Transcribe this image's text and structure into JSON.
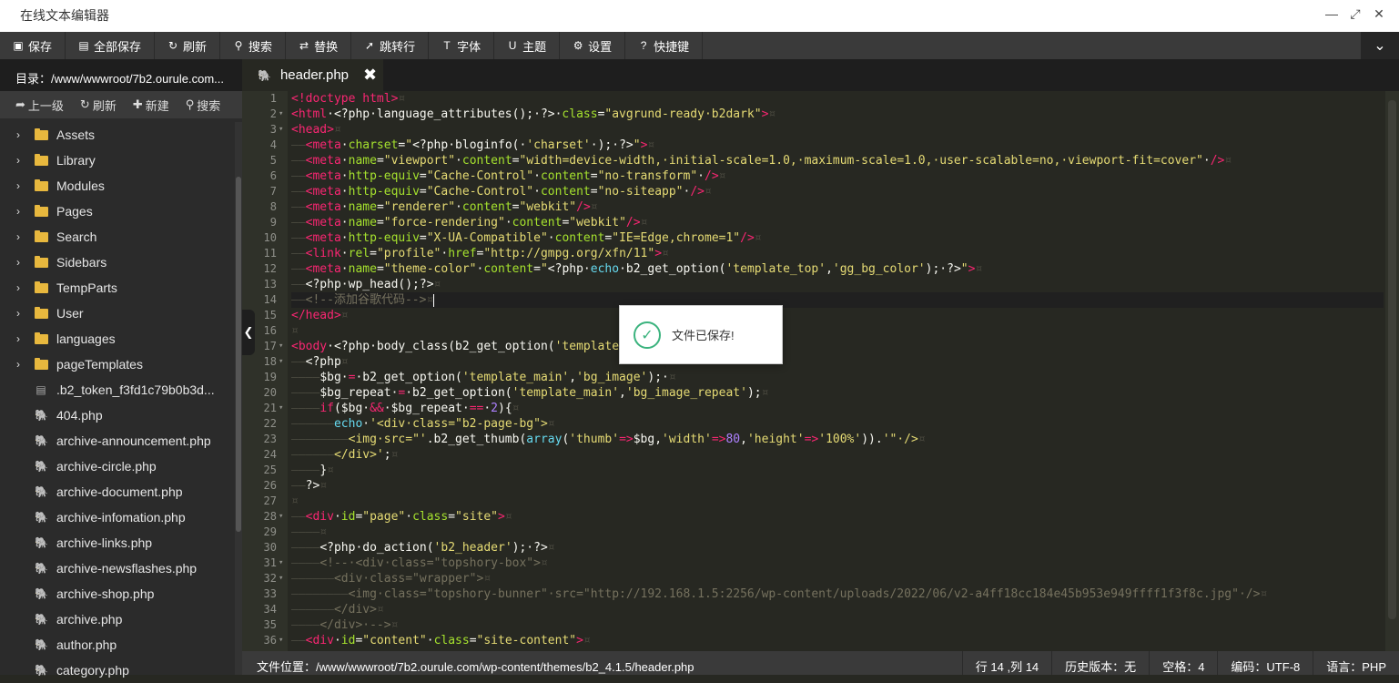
{
  "window": {
    "title": "在线文本编辑器"
  },
  "toolbar": {
    "buttons": [
      {
        "icon": "save-icon",
        "label": "保存"
      },
      {
        "icon": "file-icon",
        "label": "全部保存"
      },
      {
        "icon": "refresh-icon",
        "label": "刷新"
      },
      {
        "icon": "search-icon",
        "label": "搜索"
      },
      {
        "icon": "replace-icon",
        "label": "替换"
      },
      {
        "icon": "goto-line-icon",
        "label": "跳转行"
      },
      {
        "icon": "font-icon",
        "label": "字体"
      },
      {
        "icon": "theme-icon",
        "label": "主题"
      },
      {
        "icon": "gear-icon",
        "label": "设置"
      },
      {
        "icon": "help-icon",
        "label": "快捷键"
      }
    ]
  },
  "sidebar": {
    "dir": "目录：/www/wwwroot/7b2.ourule.com...",
    "tools": [
      {
        "icon": "up-arrow-icon",
        "label": "上一级"
      },
      {
        "icon": "refresh-icon",
        "label": "刷新"
      },
      {
        "icon": "plus-icon",
        "label": "新建"
      },
      {
        "icon": "search-icon",
        "label": "搜索"
      }
    ],
    "items": [
      {
        "type": "folder",
        "label": "Assets"
      },
      {
        "type": "folder",
        "label": "Library"
      },
      {
        "type": "folder",
        "label": "Modules"
      },
      {
        "type": "folder",
        "label": "Pages"
      },
      {
        "type": "folder",
        "label": "Search"
      },
      {
        "type": "folder",
        "label": "Sidebars"
      },
      {
        "type": "folder",
        "label": "TempParts"
      },
      {
        "type": "folder",
        "label": "User"
      },
      {
        "type": "folder",
        "label": "languages"
      },
      {
        "type": "folder",
        "label": "pageTemplates"
      },
      {
        "type": "file",
        "label": ".b2_token_f3fd1c79b0b3d..."
      },
      {
        "type": "php",
        "label": "404.php"
      },
      {
        "type": "php",
        "label": "archive-announcement.php"
      },
      {
        "type": "php",
        "label": "archive-circle.php"
      },
      {
        "type": "php",
        "label": "archive-document.php"
      },
      {
        "type": "php",
        "label": "archive-infomation.php"
      },
      {
        "type": "php",
        "label": "archive-links.php"
      },
      {
        "type": "php",
        "label": "archive-newsflashes.php"
      },
      {
        "type": "php",
        "label": "archive-shop.php"
      },
      {
        "type": "php",
        "label": "archive.php"
      },
      {
        "type": "php",
        "label": "author.php"
      },
      {
        "type": "php",
        "label": "category.php"
      }
    ]
  },
  "tab": {
    "name": "header.php",
    "close": "✖"
  },
  "toast": {
    "message": "文件已保存!"
  },
  "status": {
    "path": "文件位置：/www/wwwroot/7b2.ourule.com/wp-content/themes/b2_4.1.5/header.php",
    "cursor": "行 14 ,列 14",
    "history": "历史版本：无",
    "indent": "空格：4",
    "encoding": "编码：UTF-8",
    "language": "语言：PHP"
  },
  "code": {
    "lines": [
      [
        [
          "t",
          "<!doctype html>"
        ],
        [
          "g",
          "¤"
        ]
      ],
      [
        [
          "t",
          "<html"
        ],
        [
          "",
          "·<?php·language_attributes();·?>·"
        ],
        [
          "a",
          "class"
        ],
        [
          "",
          "="
        ],
        [
          "s",
          "\"avgrund-ready·b2dark\""
        ],
        [
          "t",
          ">"
        ],
        [
          "g",
          "¤"
        ]
      ],
      [
        [
          "t",
          "<head>"
        ],
        [
          "g",
          "¤"
        ]
      ],
      [
        [
          "g",
          "——"
        ],
        [
          "t",
          "<meta"
        ],
        [
          "",
          "·"
        ],
        [
          "a",
          "charset"
        ],
        [
          "",
          "="
        ],
        [
          "s",
          "\""
        ],
        [
          "",
          "<?php·bloginfo(·"
        ],
        [
          "s",
          "'charset'"
        ],
        [
          "",
          "·);·?>"
        ],
        [
          "s",
          "\""
        ],
        [
          "t",
          ">"
        ],
        [
          "g",
          "¤"
        ]
      ],
      [
        [
          "g",
          "——"
        ],
        [
          "t",
          "<meta"
        ],
        [
          "",
          "·"
        ],
        [
          "a",
          "name"
        ],
        [
          "",
          "="
        ],
        [
          "s",
          "\"viewport\""
        ],
        [
          "",
          "·"
        ],
        [
          "a",
          "content"
        ],
        [
          "",
          "="
        ],
        [
          "s",
          "\"width=device-width,·initial-scale=1.0,·maximum-scale=1.0,·user-scalable=no,·viewport-fit=cover\""
        ],
        [
          "",
          "·"
        ],
        [
          "t",
          "/>"
        ],
        [
          "g",
          "¤"
        ]
      ],
      [
        [
          "g",
          "——"
        ],
        [
          "t",
          "<meta"
        ],
        [
          "",
          "·"
        ],
        [
          "a",
          "http-equiv"
        ],
        [
          "",
          "="
        ],
        [
          "s",
          "\"Cache-Control\""
        ],
        [
          "",
          "·"
        ],
        [
          "a",
          "content"
        ],
        [
          "",
          "="
        ],
        [
          "s",
          "\"no-transform\""
        ],
        [
          "",
          "·"
        ],
        [
          "t",
          "/>"
        ],
        [
          "g",
          "¤"
        ]
      ],
      [
        [
          "g",
          "——"
        ],
        [
          "t",
          "<meta"
        ],
        [
          "",
          "·"
        ],
        [
          "a",
          "http-equiv"
        ],
        [
          "",
          "="
        ],
        [
          "s",
          "\"Cache-Control\""
        ],
        [
          "",
          "·"
        ],
        [
          "a",
          "content"
        ],
        [
          "",
          "="
        ],
        [
          "s",
          "\"no-siteapp\""
        ],
        [
          "",
          "·"
        ],
        [
          "t",
          "/>"
        ],
        [
          "g",
          "¤"
        ]
      ],
      [
        [
          "g",
          "——"
        ],
        [
          "t",
          "<meta"
        ],
        [
          "",
          "·"
        ],
        [
          "a",
          "name"
        ],
        [
          "",
          "="
        ],
        [
          "s",
          "\"renderer\""
        ],
        [
          "",
          "·"
        ],
        [
          "a",
          "content"
        ],
        [
          "",
          "="
        ],
        [
          "s",
          "\"webkit\""
        ],
        [
          "t",
          "/>"
        ],
        [
          "g",
          "¤"
        ]
      ],
      [
        [
          "g",
          "——"
        ],
        [
          "t",
          "<meta"
        ],
        [
          "",
          "·"
        ],
        [
          "a",
          "name"
        ],
        [
          "",
          "="
        ],
        [
          "s",
          "\"force-rendering\""
        ],
        [
          "",
          "·"
        ],
        [
          "a",
          "content"
        ],
        [
          "",
          "="
        ],
        [
          "s",
          "\"webkit\""
        ],
        [
          "t",
          "/>"
        ],
        [
          "g",
          "¤"
        ]
      ],
      [
        [
          "g",
          "——"
        ],
        [
          "t",
          "<meta"
        ],
        [
          "",
          "·"
        ],
        [
          "a",
          "http-equiv"
        ],
        [
          "",
          "="
        ],
        [
          "s",
          "\"X-UA-Compatible\""
        ],
        [
          "",
          "·"
        ],
        [
          "a",
          "content"
        ],
        [
          "",
          "="
        ],
        [
          "s",
          "\"IE=Edge,chrome=1\""
        ],
        [
          "t",
          "/>"
        ],
        [
          "g",
          "¤"
        ]
      ],
      [
        [
          "g",
          "——"
        ],
        [
          "t",
          "<link"
        ],
        [
          "",
          "·"
        ],
        [
          "a",
          "rel"
        ],
        [
          "",
          "="
        ],
        [
          "s",
          "\"profile\""
        ],
        [
          "",
          "·"
        ],
        [
          "a",
          "href"
        ],
        [
          "",
          "="
        ],
        [
          "s",
          "\"http://gmpg.org/xfn/11\""
        ],
        [
          "t",
          ">"
        ],
        [
          "g",
          "¤"
        ]
      ],
      [
        [
          "g",
          "——"
        ],
        [
          "t",
          "<meta"
        ],
        [
          "",
          "·"
        ],
        [
          "a",
          "name"
        ],
        [
          "",
          "="
        ],
        [
          "s",
          "\"theme-color\""
        ],
        [
          "",
          "·"
        ],
        [
          "a",
          "content"
        ],
        [
          "",
          "="
        ],
        [
          "s",
          "\""
        ],
        [
          "",
          "<?php·"
        ],
        [
          "k",
          "echo"
        ],
        [
          "",
          "·b2_get_option("
        ],
        [
          "s",
          "'template_top'"
        ],
        [
          "",
          ","
        ],
        [
          "s",
          "'gg_bg_color'"
        ],
        [
          "",
          ");·?>"
        ],
        [
          "s",
          "\""
        ],
        [
          "t",
          ">"
        ],
        [
          "g",
          "¤"
        ]
      ],
      [
        [
          "g",
          "——"
        ],
        [
          "",
          "<?php·wp_head();?>"
        ],
        [
          "g",
          "¤"
        ]
      ],
      [
        [
          "g",
          "——"
        ],
        [
          "c",
          "<!--添加谷歌代码-->"
        ],
        [
          "g",
          "¤"
        ]
      ],
      [
        [
          "t",
          "</head>"
        ],
        [
          "g",
          "¤"
        ]
      ],
      [
        [
          "g",
          "¤"
        ]
      ],
      [
        [
          "t",
          "<body"
        ],
        [
          "",
          "·<?php·body_class(b2_get_option("
        ],
        [
          "s",
          "'template_"
        ]
      ],
      [
        [
          "g",
          "——"
        ],
        [
          "",
          "<?php"
        ],
        [
          "g",
          "¤"
        ]
      ],
      [
        [
          "g",
          "————"
        ],
        [
          "",
          "$bg·"
        ],
        [
          "t",
          "="
        ],
        [
          "",
          "·b2_get_option("
        ],
        [
          "s",
          "'template_main'"
        ],
        [
          "",
          ","
        ],
        [
          "s",
          "'bg_image'"
        ],
        [
          "",
          ");·"
        ],
        [
          "g",
          "¤"
        ]
      ],
      [
        [
          "g",
          "————"
        ],
        [
          "",
          "$bg_repeat·"
        ],
        [
          "t",
          "="
        ],
        [
          "",
          "·b2_get_option("
        ],
        [
          "s",
          "'template_main'"
        ],
        [
          "",
          ","
        ],
        [
          "s",
          "'bg_image_repeat'"
        ],
        [
          "",
          ");"
        ],
        [
          "g",
          "¤"
        ]
      ],
      [
        [
          "g",
          "————"
        ],
        [
          "t",
          "if"
        ],
        [
          "",
          "($bg·"
        ],
        [
          "t",
          "&&"
        ],
        [
          "",
          "·$bg_repeat·"
        ],
        [
          "t",
          "=="
        ],
        [
          "",
          "·"
        ],
        [
          "n",
          "2"
        ],
        [
          "",
          "){"
        ],
        [
          "g",
          "¤"
        ]
      ],
      [
        [
          "g",
          "——————"
        ],
        [
          "k",
          "echo"
        ],
        [
          "",
          "·"
        ],
        [
          "s",
          "'<div·class=\"b2-page-bg\">"
        ],
        [
          "g",
          "¤"
        ]
      ],
      [
        [
          "g",
          "————————"
        ],
        [
          "s",
          "<img·src=\"'"
        ],
        [
          "",
          ".b2_get_thumb("
        ],
        [
          "k",
          "array"
        ],
        [
          "",
          "("
        ],
        [
          "s",
          "'thumb'"
        ],
        [
          "t",
          "=>"
        ],
        [
          "",
          "$bg,"
        ],
        [
          "s",
          "'width'"
        ],
        [
          "t",
          "=>"
        ],
        [
          "n",
          "80"
        ],
        [
          "",
          ","
        ],
        [
          "s",
          "'height'"
        ],
        [
          "t",
          "=>"
        ],
        [
          "s",
          "'100%'"
        ],
        [
          "",
          "))."
        ],
        [
          "s",
          "'\"·/>"
        ],
        [
          "g",
          "¤"
        ]
      ],
      [
        [
          "g",
          "——————"
        ],
        [
          "s",
          "</div>'"
        ],
        [
          "",
          ";"
        ],
        [
          "g",
          "¤"
        ]
      ],
      [
        [
          "g",
          "————"
        ],
        [
          "",
          "}"
        ],
        [
          "g",
          "¤"
        ]
      ],
      [
        [
          "g",
          "——"
        ],
        [
          "",
          "?>"
        ],
        [
          "g",
          "¤"
        ]
      ],
      [
        [
          "g",
          "¤"
        ]
      ],
      [
        [
          "g",
          "——"
        ],
        [
          "t",
          "<div"
        ],
        [
          "",
          "·"
        ],
        [
          "a",
          "id"
        ],
        [
          "",
          "="
        ],
        [
          "s",
          "\"page\""
        ],
        [
          "",
          "·"
        ],
        [
          "a",
          "class"
        ],
        [
          "",
          "="
        ],
        [
          "s",
          "\"site\""
        ],
        [
          "t",
          ">"
        ],
        [
          "g",
          "¤"
        ]
      ],
      [
        [
          "g",
          "————¤"
        ]
      ],
      [
        [
          "g",
          "————"
        ],
        [
          "",
          "<?php·do_action("
        ],
        [
          "s",
          "'b2_header'"
        ],
        [
          "",
          ");·?>"
        ],
        [
          "g",
          "¤"
        ]
      ],
      [
        [
          "g",
          "————"
        ],
        [
          "c",
          "<!--·<div·class=\"topshory-box\">"
        ],
        [
          "g",
          "¤"
        ]
      ],
      [
        [
          "g",
          "——————"
        ],
        [
          "c",
          "<div·class=\"wrapper\">"
        ],
        [
          "g",
          "¤"
        ]
      ],
      [
        [
          "g",
          "————————"
        ],
        [
          "c",
          "<img·class=\"topshory-bunner\"·src=\"http://192.168.1.5:2256/wp-content/uploads/2022/06/v2-a4ff18cc184e45b953e949ffff1f3f8c.jpg\"·/>"
        ],
        [
          "g",
          "¤"
        ]
      ],
      [
        [
          "g",
          "——————"
        ],
        [
          "c",
          "</div>"
        ],
        [
          "g",
          "¤"
        ]
      ],
      [
        [
          "g",
          "————"
        ],
        [
          "c",
          "</div>·-->"
        ],
        [
          "g",
          "¤"
        ]
      ],
      [
        [
          "g",
          "——"
        ],
        [
          "t",
          "<div"
        ],
        [
          "",
          "·"
        ],
        [
          "a",
          "id"
        ],
        [
          "",
          "="
        ],
        [
          "s",
          "\"content\""
        ],
        [
          "",
          "·"
        ],
        [
          "a",
          "class"
        ],
        [
          "",
          "="
        ],
        [
          "s",
          "\"site-content\""
        ],
        [
          "t",
          ">"
        ],
        [
          "g",
          "¤"
        ]
      ]
    ],
    "fold_lines": [
      2,
      3,
      17,
      18,
      21,
      28,
      31,
      32,
      36
    ],
    "active_line": 14
  }
}
